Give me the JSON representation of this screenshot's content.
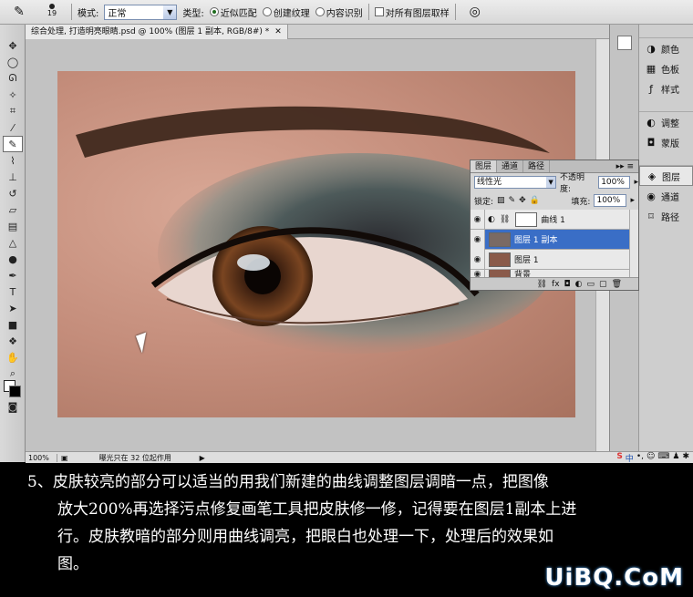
{
  "options_bar": {
    "brush_size": "19",
    "mode_label": "模式:",
    "mode_value": "正常",
    "type_label": "类型:",
    "type_options": [
      "近似匹配",
      "创建纹理",
      "内容识别"
    ],
    "sample_all_label": "对所有图层取样"
  },
  "document": {
    "tab_title": "综合处理, 打造明亮眼睛.psd @ 100% (图层 1 副本, RGB/8#) *",
    "tab_close": "✕",
    "zoom": "100%",
    "status_info": "曝光只在 32 位起作用"
  },
  "dock": {
    "group1": [
      {
        "label": "颜色",
        "icon": "color-icon"
      },
      {
        "label": "色板",
        "icon": "swatches-icon"
      },
      {
        "label": "样式",
        "icon": "styles-icon"
      }
    ],
    "group2": [
      {
        "label": "调整",
        "icon": "adjust-icon"
      },
      {
        "label": "蒙版",
        "icon": "mask-icon"
      }
    ],
    "group3": [
      {
        "label": "图层",
        "icon": "layers-icon"
      },
      {
        "label": "通道",
        "icon": "channels-icon"
      },
      {
        "label": "路径",
        "icon": "paths-icon"
      }
    ]
  },
  "layers_panel": {
    "tabs": [
      "图层",
      "通道",
      "路径"
    ],
    "blend_mode": "线性光",
    "opacity_label": "不透明度:",
    "opacity_value": "100%",
    "lock_label": "锁定:",
    "fill_label": "填充:",
    "fill_value": "100%",
    "layers": [
      {
        "name": "曲线 1",
        "type": "adjustment"
      },
      {
        "name": "图层 1 副本",
        "type": "pixel",
        "selected": true
      },
      {
        "name": "图层 1",
        "type": "pixel"
      },
      {
        "name": "背景",
        "type": "pixel"
      }
    ]
  },
  "caption": {
    "line1": "5、皮肤较亮的部分可以适当的用我们新建的曲线调整图层调暗一点，把图像",
    "line2": "放大200%再选择污点修复画笔工具把皮肤修一修，记得要在图层1副本上进",
    "line3": "行。皮肤教暗的部分则用曲线调亮，把眼白也处理一下，处理后的效果如",
    "line4": "图。"
  },
  "watermark": "UiBQ.CoM",
  "ime_indicator": "中"
}
